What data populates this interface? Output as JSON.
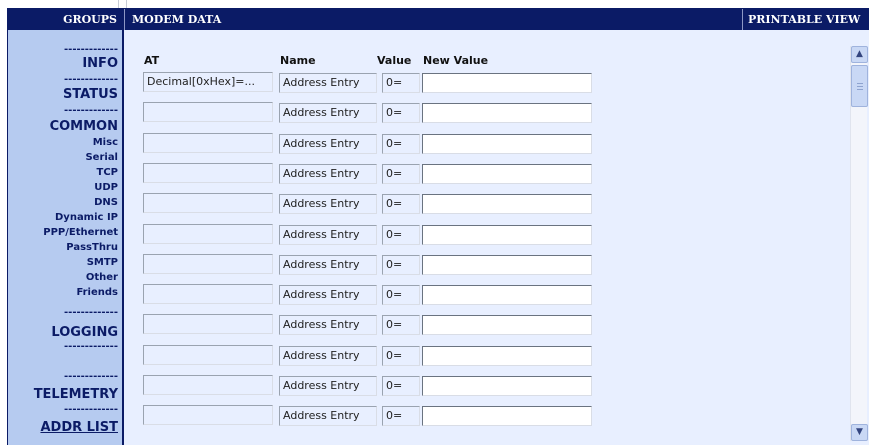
{
  "topbar": {
    "groups": "GROUPS",
    "modem_data": "MODEM DATA",
    "printable_view": "PRINTABLE VIEW"
  },
  "sidebar": {
    "dashes": "-------------",
    "info": "INFO",
    "status": "STATUS",
    "common": "COMMON",
    "misc": "Misc",
    "serial": "Serial",
    "tcp": "TCP",
    "udp": "UDP",
    "dns": "DNS",
    "dynamic_ip": "Dynamic IP",
    "ppp_ethernet": "PPP/Ethernet",
    "passthru": "PassThru",
    "smtp": "SMTP",
    "other": "Other",
    "friends": "Friends",
    "logging": "LOGGING",
    "telemetry": "TELEMETRY",
    "addr_list": "ADDR LIST"
  },
  "table": {
    "headers": {
      "at": "AT",
      "name": "Name",
      "value": "Value",
      "new_value": "New Value"
    },
    "rows": [
      {
        "at": "Decimal[0xHex]=...",
        "name": "Address Entry",
        "value": "0=",
        "new_value": ""
      },
      {
        "at": "",
        "name": "Address Entry",
        "value": "0=",
        "new_value": ""
      },
      {
        "at": "",
        "name": "Address Entry",
        "value": "0=",
        "new_value": ""
      },
      {
        "at": "",
        "name": "Address Entry",
        "value": "0=",
        "new_value": ""
      },
      {
        "at": "",
        "name": "Address Entry",
        "value": "0=",
        "new_value": ""
      },
      {
        "at": "",
        "name": "Address Entry",
        "value": "0=",
        "new_value": ""
      },
      {
        "at": "",
        "name": "Address Entry",
        "value": "0=",
        "new_value": ""
      },
      {
        "at": "",
        "name": "Address Entry",
        "value": "0=",
        "new_value": ""
      },
      {
        "at": "",
        "name": "Address Entry",
        "value": "0=",
        "new_value": ""
      },
      {
        "at": "",
        "name": "Address Entry",
        "value": "0=",
        "new_value": ""
      },
      {
        "at": "",
        "name": "Address Entry",
        "value": "0=",
        "new_value": ""
      },
      {
        "at": "",
        "name": "Address Entry",
        "value": "0=",
        "new_value": ""
      }
    ]
  },
  "scrollbar": {
    "up_icon": "chevron-up-icon",
    "down_icon": "chevron-down-icon"
  },
  "colors": {
    "header_bg": "#0b1b66",
    "sidebar_bg": "#b6cbf0",
    "content_bg": "#e8efff"
  }
}
